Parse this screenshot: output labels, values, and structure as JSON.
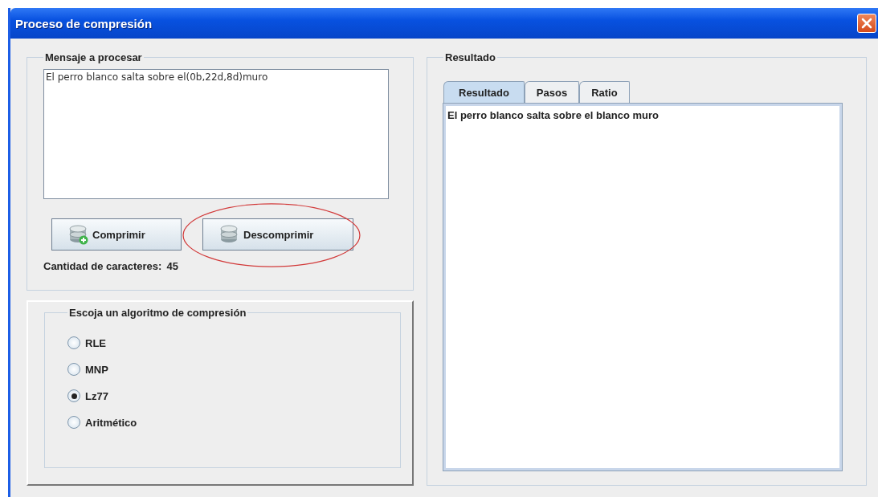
{
  "window": {
    "title": "Proceso de compresión"
  },
  "message_group": {
    "title": "Mensaje a procesar",
    "text": "El perro blanco salta sobre el(0b,22d,8d)muro",
    "buttons": [
      {
        "label": "Comprimir",
        "kind": "compress",
        "circled": false
      },
      {
        "label": "Descomprimir",
        "kind": "decompress",
        "circled": true
      }
    ],
    "count_label": "Cantidad de caracteres:",
    "count_value": "45"
  },
  "algorithm_group": {
    "title": "Escoja un algoritmo de compresión",
    "options": [
      {
        "label": "RLE",
        "selected": false
      },
      {
        "label": "MNP",
        "selected": false
      },
      {
        "label": "Lz77",
        "selected": true
      },
      {
        "label": "Aritmético",
        "selected": false
      }
    ]
  },
  "result_group": {
    "title": "Resultado",
    "tabs": [
      {
        "label": "Resultado",
        "selected": true
      },
      {
        "label": "Pasos",
        "selected": false
      },
      {
        "label": "Ratio",
        "selected": false
      }
    ],
    "text": "El perro blanco salta sobre el blanco muro"
  }
}
